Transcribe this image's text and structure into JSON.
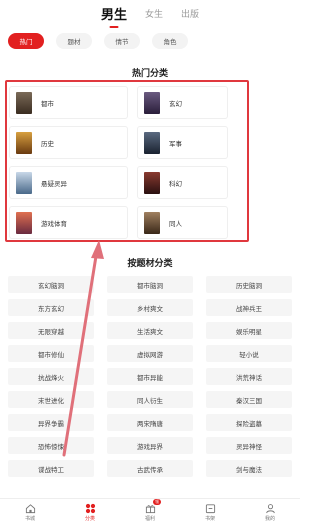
{
  "top_tabs": [
    {
      "label": "男生",
      "active": true
    },
    {
      "label": "女生",
      "active": false
    },
    {
      "label": "出版",
      "active": false
    }
  ],
  "filter_chips": [
    {
      "label": "热门",
      "active": true
    },
    {
      "label": "题材",
      "active": false
    },
    {
      "label": "情节",
      "active": false
    },
    {
      "label": "角色",
      "active": false
    }
  ],
  "hot_section": {
    "title": "热门分类",
    "categories": [
      {
        "label": "都市",
        "cover_color": "#5a4a3a"
      },
      {
        "label": "玄幻",
        "cover_color": "#4a3a5e"
      },
      {
        "label": "历史",
        "cover_color": "#a8742c"
      },
      {
        "label": "军事",
        "cover_color": "#2f3f55"
      },
      {
        "label": "悬疑灵异",
        "cover_color": "#6d8fb0"
      },
      {
        "label": "科幻",
        "cover_color": "#5e2a2a"
      },
      {
        "label": "游戏体育",
        "cover_color": "#b84a3a"
      },
      {
        "label": "同人",
        "cover_color": "#7a5a3a"
      }
    ]
  },
  "genre_section": {
    "title": "按题材分类",
    "items": [
      "玄幻脑洞",
      "都市脑洞",
      "历史脑洞",
      "东方玄幻",
      "乡村爽文",
      "战神兵王",
      "无限穿越",
      "生活爽文",
      "娱乐明星",
      "都市修仙",
      "虚拟网游",
      "轻小说",
      "抗战烽火",
      "都市异能",
      "洪荒神话",
      "末世进化",
      "同人衍生",
      "秦汉三国",
      "异界争霸",
      "两宋隋唐",
      "探险盗墓",
      "恐怖惊悚",
      "游戏异界",
      "灵异神怪",
      "谍战特工",
      "古武传承",
      "剑与魔法"
    ]
  },
  "bottom_nav": [
    {
      "label": "书城",
      "icon": "home-icon",
      "active": false
    },
    {
      "label": "分类",
      "icon": "category-icon",
      "active": true
    },
    {
      "label": "福利",
      "icon": "gift-icon",
      "active": false,
      "badge": "领"
    },
    {
      "label": "书架",
      "icon": "bookshelf-icon",
      "active": false
    },
    {
      "label": "我的",
      "icon": "profile-icon",
      "active": false
    }
  ],
  "colors": {
    "accent": "#e22020",
    "highlight_box": "#e0383e"
  }
}
